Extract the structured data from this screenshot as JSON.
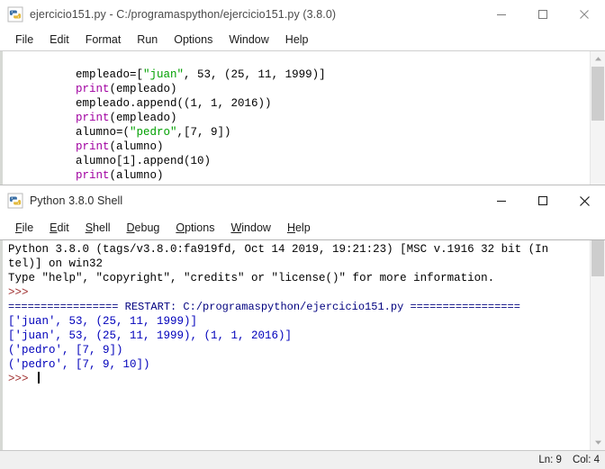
{
  "editor_window": {
    "icon": "python-idle-icon",
    "title": "ejercicio151.py - C:/programaspython/ejercicio151.py (3.8.0)",
    "caption": {
      "minimize": "—",
      "maximize": "☐",
      "close": "✕"
    },
    "menus": [
      {
        "label": "File",
        "mnemonic": "F",
        "rest": "ile"
      },
      {
        "label": "Edit",
        "mnemonic": "E",
        "rest": "dit"
      },
      {
        "label": "Format",
        "mnemonic": "F",
        "rest": "ormat"
      },
      {
        "label": "Run",
        "mnemonic": "R",
        "rest": "un"
      },
      {
        "label": "Options",
        "mnemonic": "O",
        "rest": "ptions"
      },
      {
        "label": "Window",
        "mnemonic": "W",
        "rest": "indow"
      },
      {
        "label": "Help",
        "mnemonic": "H",
        "rest": "elp"
      }
    ],
    "code_lines": [
      [
        {
          "t": "empleado=[",
          "c": "plain"
        },
        {
          "t": "\"juan\"",
          "c": "str"
        },
        {
          "t": ", 53, (25, 11, 1999)]",
          "c": "plain"
        }
      ],
      [
        {
          "t": "print",
          "c": "kw"
        },
        {
          "t": "(empleado)",
          "c": "plain"
        }
      ],
      [
        {
          "t": "empleado.append((1, 1, 2016))",
          "c": "plain"
        }
      ],
      [
        {
          "t": "print",
          "c": "kw"
        },
        {
          "t": "(empleado)",
          "c": "plain"
        }
      ],
      [
        {
          "t": "alumno=(",
          "c": "plain"
        },
        {
          "t": "\"pedro\"",
          "c": "str"
        },
        {
          "t": ",[7, 9])",
          "c": "plain"
        }
      ],
      [
        {
          "t": "print",
          "c": "kw"
        },
        {
          "t": "(alumno)",
          "c": "plain"
        }
      ],
      [
        {
          "t": "alumno[1].append(10)",
          "c": "plain"
        }
      ],
      [
        {
          "t": "print",
          "c": "kw"
        },
        {
          "t": "(alumno)",
          "c": "plain"
        }
      ]
    ]
  },
  "shell_window": {
    "icon": "python-idle-icon",
    "title": "Python 3.8.0 Shell",
    "caption": {
      "minimize": "—",
      "maximize": "☐",
      "close": "✕"
    },
    "menus": [
      {
        "label": "File",
        "mnemonic": "F",
        "rest": "ile"
      },
      {
        "label": "Edit",
        "mnemonic": "E",
        "rest": "dit"
      },
      {
        "label": "Shell",
        "mnemonic": "S",
        "rest": "hell"
      },
      {
        "label": "Debug",
        "mnemonic": "D",
        "rest": "ebug"
      },
      {
        "label": "Options",
        "mnemonic": "O",
        "rest": "ptions"
      },
      {
        "label": "Window",
        "mnemonic": "W",
        "rest": "indow"
      },
      {
        "label": "Help",
        "mnemonic": "H",
        "rest": "elp"
      }
    ],
    "output_lines": [
      {
        "text": "Python 3.8.0 (tags/v3.8.0:fa919fd, Oct 14 2019, 19:21:23) [MSC v.1916 32 bit (In",
        "c": "normal"
      },
      {
        "text": "tel)] on win32",
        "c": "normal"
      },
      {
        "text": "Type \"help\", \"copyright\", \"credits\" or \"license()\" for more information.",
        "c": "normal"
      },
      {
        "text": ">>> ",
        "c": "prompt"
      },
      {
        "text": "================= RESTART: C:/programaspython/ejercicio151.py =================",
        "c": "restart"
      },
      {
        "text": "['juan', 53, (25, 11, 1999)]",
        "c": "out"
      },
      {
        "text": "['juan', 53, (25, 11, 1999), (1, 1, 2016)]",
        "c": "out"
      },
      {
        "text": "('pedro', [7, 9])",
        "c": "out"
      },
      {
        "text": "('pedro', [7, 9, 10])",
        "c": "out"
      }
    ],
    "final_prompt": ">>> ",
    "status": {
      "line_label": "Ln: 9",
      "col_label": "Col: 4"
    }
  },
  "colors": {
    "string": "#00a000",
    "keyword": "#a000a0",
    "shell_output": "#0000bb",
    "shell_prompt": "#a03030",
    "restart": "#00007f"
  }
}
